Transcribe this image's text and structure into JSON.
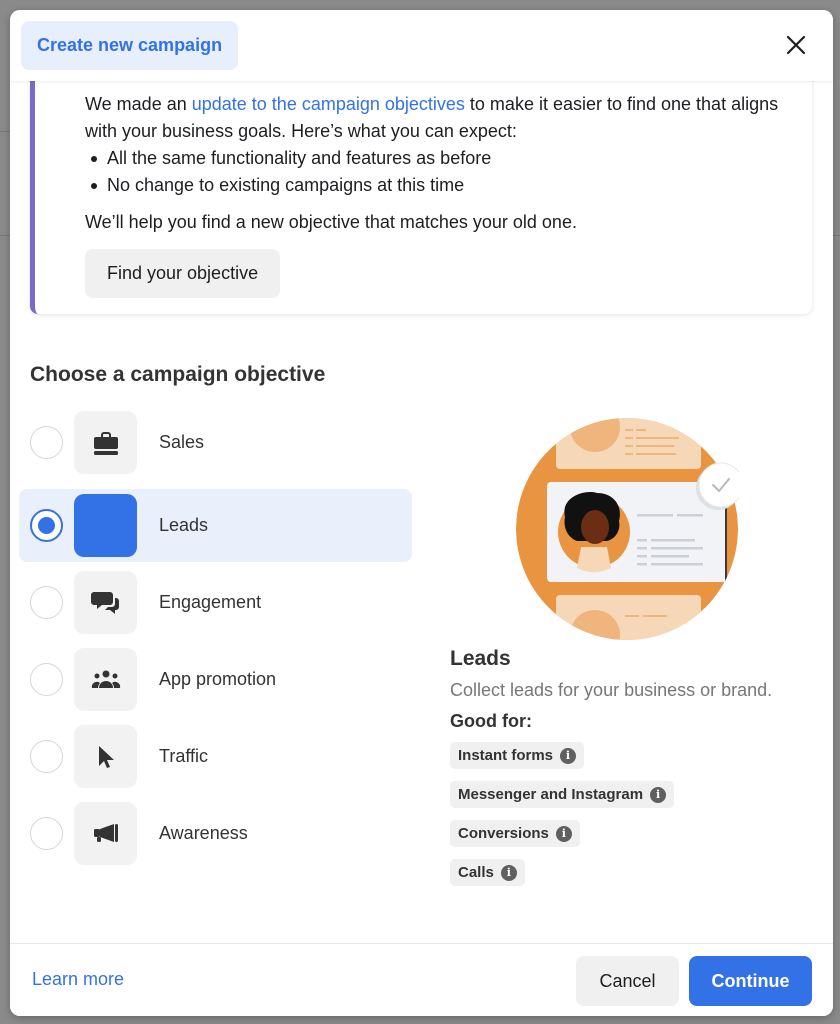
{
  "dialog": {
    "title": "Create new campaign",
    "close_icon": "close-icon"
  },
  "notice": {
    "text_before_link": "We made an ",
    "link_text": "update to the campaign objectives",
    "text_after_link": " to make it easier to find one that aligns with your business goals. Here’s what you can expect:",
    "bullets": [
      "All the same functionality and features as before",
      "No change to existing campaigns at this time"
    ],
    "help_text": "We’ll help you find a new objective that matches your old one.",
    "button_label": "Find your objective",
    "accent_color": "#7b68c8"
  },
  "objectives": {
    "title": "Choose a campaign objective",
    "selected": "Leads",
    "items": [
      {
        "label": "Sales",
        "icon": "briefcase-icon",
        "selected": false
      },
      {
        "label": "Leads",
        "icon": "leads-icon",
        "selected": true
      },
      {
        "label": "Engagement",
        "icon": "chat-bubbles-icon",
        "selected": false
      },
      {
        "label": "App promotion",
        "icon": "people-group-icon",
        "selected": false
      },
      {
        "label": "Traffic",
        "icon": "cursor-pointer-icon",
        "selected": false
      },
      {
        "label": "Awareness",
        "icon": "megaphone-icon",
        "selected": false
      }
    ]
  },
  "detail": {
    "illustration": "lead-card-illustration",
    "title": "Leads",
    "description": "Collect leads for your business or brand.",
    "good_for_label": "Good for:",
    "tags": [
      {
        "label": "Instant forms",
        "icon": "info-icon"
      },
      {
        "label": "Messenger and Instagram",
        "icon": "info-icon"
      },
      {
        "label": "Conversions",
        "icon": "info-icon"
      },
      {
        "label": "Calls",
        "icon": "info-icon"
      }
    ]
  },
  "footer": {
    "learn_more": "Learn more",
    "cancel": "Cancel",
    "continue": "Continue"
  },
  "colors": {
    "primary": "#3372e6",
    "selected_bg": "#e9f0fc",
    "illustration_orange": "#e99441"
  }
}
